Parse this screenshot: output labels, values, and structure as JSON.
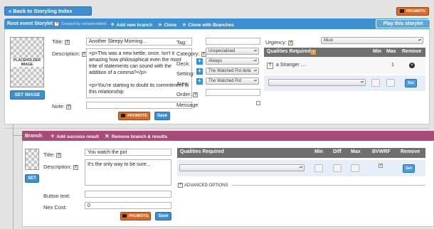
{
  "nav": {
    "back_label": "« Back to Storyling Index"
  },
  "promote_label": "PROMOTE",
  "storylet": {
    "header": {
      "title": "Root event Storylet",
      "created_by": "Created by richardcobbett",
      "add_branch": "Add new branch",
      "clone": "Clone",
      "clone_branches": "Clone with Branches",
      "play": "Play this storylet"
    },
    "image_placeholder": "PLACEHOLDER IMAGE",
    "set_image": "SET IMAGE",
    "title_label": "Title:",
    "title_value": "Another Sleepy Morning...",
    "description_label": "Description:",
    "description_p1": "<p>This was a new kettle, once. Isn't it amazing how philosophical even the most trite of statements can sound with the addition of a comma?</p>",
    "description_p2": "<p>You're starting to doubt its commitment to this relationship",
    "note_label": "Note:",
    "note_value": "",
    "save_label": "Save",
    "tag_label": "Tag:",
    "tag_value": "",
    "category_label": "Category:",
    "category_value": "Unspecialised",
    "deck_label": "Deck:",
    "deck_value": "Always",
    "setting_label": "Setting:",
    "setting_value": "The Watched Pot defa",
    "area_label": "Area:",
    "area_value": "The Watched Pot",
    "order_label": "Order:",
    "order_value": "",
    "message_label": "Message",
    "urgency_label": "Urgency:",
    "urgency_value": "Must",
    "qualities": {
      "header": "Qualities Required",
      "min": "Min",
      "max": "Max",
      "remove": "Remove",
      "rows": [
        {
          "name": "a Stranger ...",
          "min": "",
          "max": "1"
        }
      ],
      "set_label": "Set"
    }
  },
  "branch": {
    "header": {
      "title": "Branch",
      "add_success": "Add success result",
      "remove": "Remove branch & results"
    },
    "set_label": "SET",
    "title_label": "Title:",
    "title_value": "You watch the pot",
    "description_label": "Description:",
    "description_value": "It's the only way to be sure...",
    "button_text_label": "Button text:",
    "button_text_value": "",
    "nex_cost_label": "Nex Cost:",
    "nex_cost_value": "0",
    "save_label": "Save",
    "qualities": {
      "header": "Qualities Required",
      "min": "Min",
      "diff": "Diff",
      "max": "Max",
      "bvwrf": "BVWRF",
      "remove": "Remove",
      "set_label": "Set",
      "bvwrf_checked": true
    },
    "advanced_label": "ADVANCED OPTIONS"
  },
  "colors": {
    "primary": "#3c8fd2",
    "branch": "#a94a77",
    "promote": "#d96a2a"
  }
}
